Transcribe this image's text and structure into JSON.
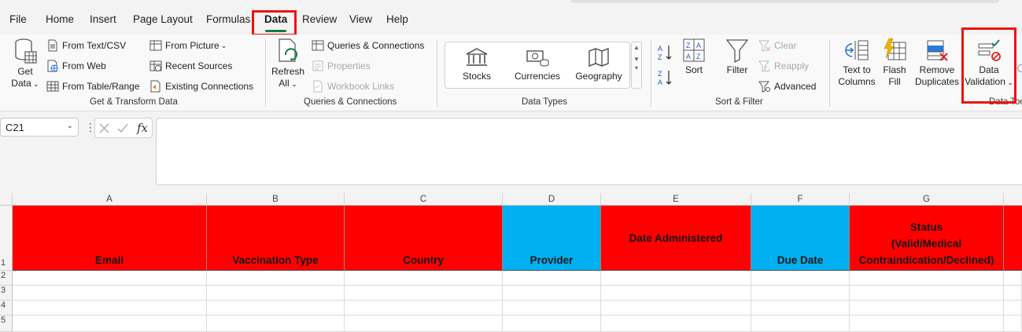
{
  "menu": {
    "tabs": [
      "File",
      "Home",
      "Insert",
      "Page Layout",
      "Formulas",
      "Data",
      "Review",
      "View",
      "Help"
    ],
    "active_tab": "Data"
  },
  "ribbon": {
    "get_transform": {
      "get_data_line1": "Get",
      "get_data_line2": "Data",
      "from_text_csv": "From Text/CSV",
      "from_web": "From Web",
      "from_table_range": "From Table/Range",
      "from_picture": "From Picture",
      "recent_sources": "Recent Sources",
      "existing_connections": "Existing Connections",
      "label": "Get & Transform Data"
    },
    "queries": {
      "refresh_line1": "Refresh",
      "refresh_line2": "All",
      "queries_connections": "Queries & Connections",
      "properties": "Properties",
      "workbook_links": "Workbook Links",
      "label": "Queries & Connections"
    },
    "data_types": {
      "stocks": "Stocks",
      "currencies": "Currencies",
      "geography": "Geography",
      "label": "Data Types"
    },
    "sort_filter": {
      "sort": "Sort",
      "filter": "Filter",
      "clear": "Clear",
      "reapply": "Reapply",
      "advanced": "Advanced",
      "label": "Sort & Filter"
    },
    "data_tools": {
      "text_to_columns_line1": "Text to",
      "text_to_columns_line2": "Columns",
      "flash_fill_line1": "Flash",
      "flash_fill_line2": "Fill",
      "remove_duplicates_line1": "Remove",
      "remove_duplicates_line2": "Duplicates",
      "data_validation_line1": "Data",
      "data_validation_line2": "Validation",
      "label": "Data Too"
    }
  },
  "formula_bar": {
    "name_box": "C21",
    "fx": "fx",
    "formula": ""
  },
  "grid": {
    "columns": [
      "A",
      "B",
      "C",
      "D",
      "E",
      "F",
      "G"
    ],
    "rows": [
      "1",
      "2",
      "3",
      "4",
      "5"
    ],
    "headers": {
      "A": "Email",
      "B": "Vaccination Type",
      "C": "Country",
      "D": "Provider",
      "E": "Date Administered",
      "F": "Due Date",
      "G_line1": "Status",
      "G_line2": "(Valid/Medical",
      "G_line3": "Contraindication/Declined)"
    }
  },
  "colors": {
    "header_red": "#ff0000",
    "header_blue": "#00b0f0",
    "excel_green": "#107c41",
    "highlight_red": "#ee1111"
  }
}
